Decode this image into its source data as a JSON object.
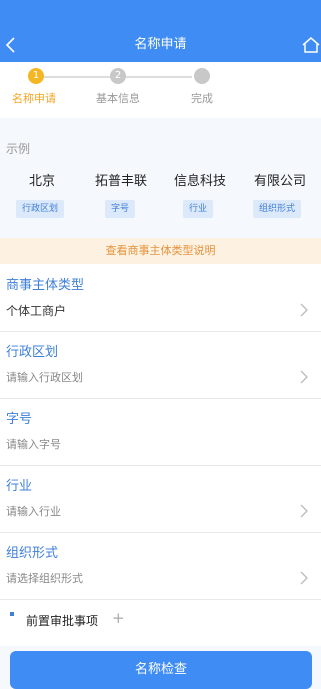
{
  "header": {
    "title": "名称申请"
  },
  "steps": [
    {
      "number": "1",
      "label": "名称申请",
      "active": true
    },
    {
      "number": "2",
      "label": "基本信息",
      "active": false
    },
    {
      "number": "",
      "label": "完成",
      "active": false
    }
  ],
  "example": {
    "title": "示例",
    "parts": [
      {
        "word": "北京",
        "tag": "行政区划"
      },
      {
        "word": "拓普丰联",
        "tag": "字号"
      },
      {
        "word": "信息科技",
        "tag": "行业"
      },
      {
        "word": "有限公司",
        "tag": "组织形式"
      }
    ]
  },
  "hint": {
    "text": "查看商事主体类型说明"
  },
  "form": {
    "entity_type": {
      "label": "商事主体类型",
      "value": "个体工商户"
    },
    "region": {
      "label": "行政区划",
      "placeholder": "请输入行政区划"
    },
    "trade_name": {
      "label": "字号",
      "placeholder": "请输入字号"
    },
    "industry": {
      "label": "行业",
      "placeholder": "请输入行业"
    },
    "org_form": {
      "label": "组织形式",
      "placeholder": "请选择组织形式"
    }
  },
  "pre_approval": {
    "label": "前置审批事项",
    "plus": "+"
  },
  "button": {
    "label": "名称检查"
  },
  "colors": {
    "primary": "#3f8cf4",
    "active_step": "#f5b623",
    "hint_bg": "#fdf1e2",
    "hint_text": "#e4933b"
  }
}
